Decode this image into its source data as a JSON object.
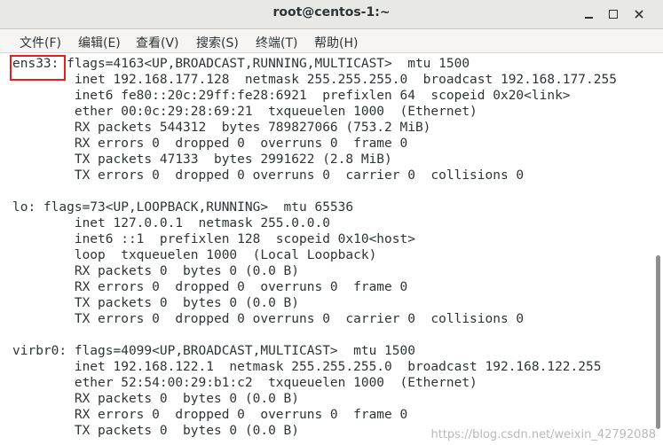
{
  "window": {
    "title": "root@centos-1:~"
  },
  "menu": [
    "文件(F)",
    "编辑(E)",
    "查看(V)",
    "搜索(S)",
    "终端(T)",
    "帮助(H)"
  ],
  "terminal": {
    "lines": [
      "ens33: flags=4163<UP,BROADCAST,RUNNING,MULTICAST>  mtu 1500",
      "        inet 192.168.177.128  netmask 255.255.255.0  broadcast 192.168.177.255",
      "        inet6 fe80::20c:29ff:fe28:6921  prefixlen 64  scopeid 0x20<link>",
      "        ether 00:0c:29:28:69:21  txqueuelen 1000  (Ethernet)",
      "        RX packets 544312  bytes 789827066 (753.2 MiB)",
      "        RX errors 0  dropped 0  overruns 0  frame 0",
      "        TX packets 47133  bytes 2991622 (2.8 MiB)",
      "        TX errors 0  dropped 0 overruns 0  carrier 0  collisions 0",
      "",
      "lo: flags=73<UP,LOOPBACK,RUNNING>  mtu 65536",
      "        inet 127.0.0.1  netmask 255.0.0.0",
      "        inet6 ::1  prefixlen 128  scopeid 0x10<host>",
      "        loop  txqueuelen 1000  (Local Loopback)",
      "        RX packets 0  bytes 0 (0.0 B)",
      "        RX errors 0  dropped 0  overruns 0  frame 0",
      "        TX packets 0  bytes 0 (0.0 B)",
      "        TX errors 0  dropped 0 overruns 0  carrier 0  collisions 0",
      "",
      "virbr0: flags=4099<UP,BROADCAST,MULTICAST>  mtu 1500",
      "        inet 192.168.122.1  netmask 255.255.255.0  broadcast 192.168.122.255",
      "        ether 52:54:00:29:b1:c2  txqueuelen 1000  (Ethernet)",
      "        RX packets 0  bytes 0 (0.0 B)",
      "        RX errors 0  dropped 0  overruns 0  frame 0",
      "        TX packets 0  bytes 0 (0.0 B)"
    ]
  },
  "watermark": "https://blog.csdn.net/weixin_42792088",
  "colors": {
    "highlight_box": "#e0211d",
    "terminal_text": "#2e3436"
  }
}
